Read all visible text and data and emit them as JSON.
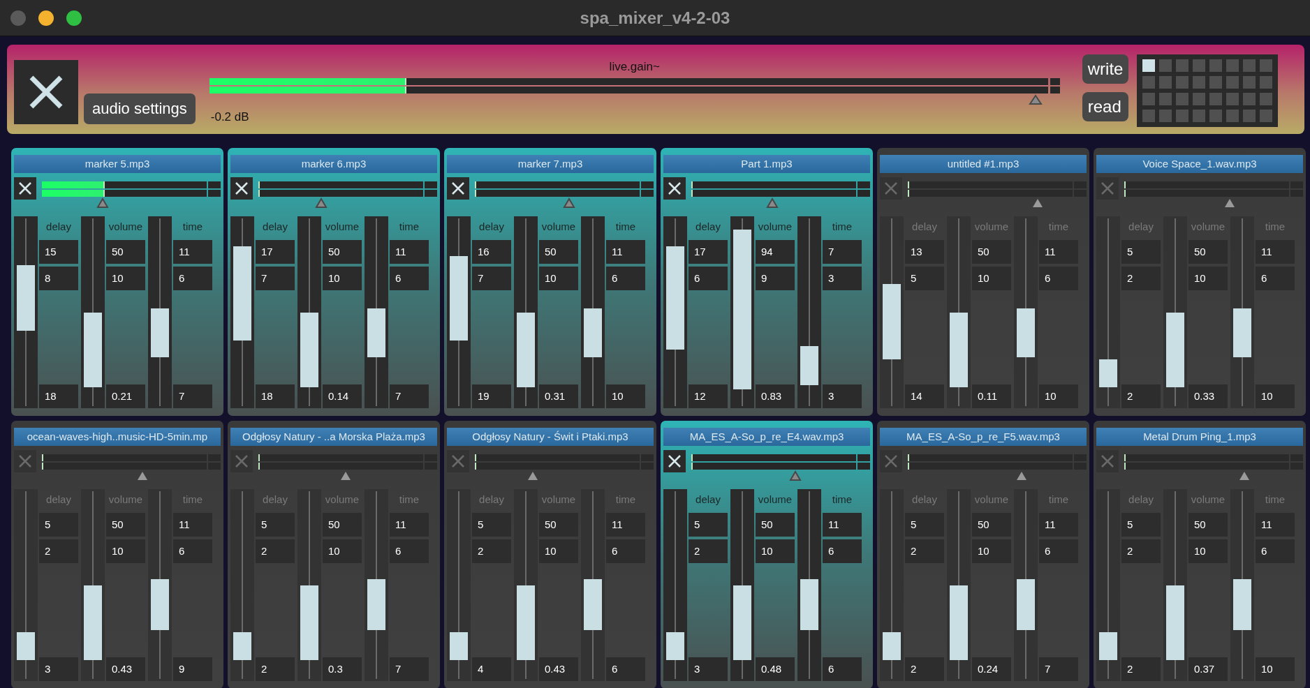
{
  "window": {
    "title": "spa_mixer_v4-2-03"
  },
  "header": {
    "settings_button": "audio settings",
    "gain_label": "live.gain~",
    "meter": {
      "level": 0.235
    },
    "gain_slider": {
      "level": 0.985
    },
    "gain_reading": "-0.2 dB",
    "write_button": "write",
    "read_button": "read",
    "presets": [
      {
        "selected": true
      },
      {
        "selected": false
      },
      {
        "selected": false
      },
      {
        "selected": false
      },
      {
        "selected": false
      },
      {
        "selected": false
      },
      {
        "selected": false
      },
      {
        "selected": false
      },
      {
        "selected": false
      },
      {
        "selected": false
      },
      {
        "selected": false
      },
      {
        "selected": false
      },
      {
        "selected": false
      },
      {
        "selected": false
      },
      {
        "selected": false
      },
      {
        "selected": false
      },
      {
        "selected": false
      },
      {
        "selected": false
      },
      {
        "selected": false
      },
      {
        "selected": false
      },
      {
        "selected": false
      },
      {
        "selected": false
      },
      {
        "selected": false
      },
      {
        "selected": false
      },
      {
        "selected": false
      },
      {
        "selected": false
      },
      {
        "selected": false
      },
      {
        "selected": false
      },
      {
        "selected": false
      },
      {
        "selected": false
      },
      {
        "selected": false
      },
      {
        "selected": false
      }
    ]
  },
  "channels": [
    {
      "name": "marker 5.mp3",
      "on": true,
      "meter": {
        "level": 0.38
      },
      "gain": {
        "level": 0.37
      },
      "params": [
        {
          "label": "delay",
          "value_1": "15",
          "value_2": "8",
          "value_3": "18",
          "low": {
            "level": 0.4
          },
          "high": {
            "level": 0.75
          }
        },
        {
          "label": "volume",
          "value_1": "50",
          "value_2": "10",
          "value_3": "0.21",
          "low": {
            "level": 0.1
          },
          "high": {
            "level": 0.5
          }
        },
        {
          "label": "time",
          "value_1": "11",
          "value_2": "6",
          "value_3": "7",
          "low": {
            "level": 0.26
          },
          "high": {
            "level": 0.52
          }
        }
      ]
    },
    {
      "name": "marker 6.mp3",
      "on": true,
      "meter": {
        "level": 0
      },
      "gain": {
        "level": 0.38
      },
      "params": [
        {
          "label": "delay",
          "value_1": "17",
          "value_2": "7",
          "value_3": "18",
          "low": {
            "level": 0.35
          },
          "high": {
            "level": 0.85
          }
        },
        {
          "label": "volume",
          "value_1": "50",
          "value_2": "10",
          "value_3": "0.14",
          "low": {
            "level": 0.1
          },
          "high": {
            "level": 0.5
          }
        },
        {
          "label": "time",
          "value_1": "11",
          "value_2": "6",
          "value_3": "7",
          "low": {
            "level": 0.26
          },
          "high": {
            "level": 0.52
          }
        }
      ]
    },
    {
      "name": "marker 7.mp3",
      "on": true,
      "meter": {
        "level": 0
      },
      "gain": {
        "level": 0.57
      },
      "params": [
        {
          "label": "delay",
          "value_1": "16",
          "value_2": "7",
          "value_3": "19",
          "low": {
            "level": 0.35
          },
          "high": {
            "level": 0.8
          }
        },
        {
          "label": "volume",
          "value_1": "50",
          "value_2": "10",
          "value_3": "0.31",
          "low": {
            "level": 0.1
          },
          "high": {
            "level": 0.5
          }
        },
        {
          "label": "time",
          "value_1": "11",
          "value_2": "6",
          "value_3": "10",
          "low": {
            "level": 0.26
          },
          "high": {
            "level": 0.52
          }
        }
      ]
    },
    {
      "name": "Part 1.mp3",
      "on": true,
      "meter": {
        "level": 0
      },
      "gain": {
        "level": 0.49
      },
      "params": [
        {
          "label": "delay",
          "value_1": "17",
          "value_2": "6",
          "value_3": "12",
          "low": {
            "level": 0.3
          },
          "high": {
            "level": 0.85
          }
        },
        {
          "label": "volume",
          "value_1": "94",
          "value_2": "9",
          "value_3": "0.83",
          "low": {
            "level": 0.09
          },
          "high": {
            "level": 0.94
          }
        },
        {
          "label": "time",
          "value_1": "7",
          "value_2": "3",
          "value_3": "3",
          "low": {
            "level": 0.11
          },
          "high": {
            "level": 0.32
          }
        }
      ]
    },
    {
      "name": "untitled #1.mp3",
      "on": false,
      "meter": {
        "level": 0
      },
      "gain": {
        "level": 0.79
      },
      "params": [
        {
          "label": "delay",
          "value_1": "13",
          "value_2": "5",
          "value_3": "14",
          "low": {
            "level": 0.25
          },
          "high": {
            "level": 0.65
          }
        },
        {
          "label": "volume",
          "value_1": "50",
          "value_2": "10",
          "value_3": "0.11",
          "low": {
            "level": 0.1
          },
          "high": {
            "level": 0.5
          }
        },
        {
          "label": "time",
          "value_1": "11",
          "value_2": "6",
          "value_3": "10",
          "low": {
            "level": 0.26
          },
          "high": {
            "level": 0.52
          }
        }
      ]
    },
    {
      "name": "Voice Space_1.wav.mp3",
      "on": false,
      "meter": {
        "level": 0
      },
      "gain": {
        "level": 0.64
      },
      "params": [
        {
          "label": "delay",
          "value_1": "5",
          "value_2": "2",
          "value_3": "2",
          "low": {
            "level": 0.1
          },
          "high": {
            "level": 0.25
          }
        },
        {
          "label": "volume",
          "value_1": "50",
          "value_2": "10",
          "value_3": "0.33",
          "low": {
            "level": 0.1
          },
          "high": {
            "level": 0.5
          }
        },
        {
          "label": "time",
          "value_1": "11",
          "value_2": "6",
          "value_3": "10",
          "low": {
            "level": 0.26
          },
          "high": {
            "level": 0.52
          }
        }
      ]
    },
    {
      "name": "ocean-waves-high..music-HD-5min.mp",
      "on": false,
      "meter": {
        "level": 0
      },
      "gain": {
        "level": 0.61
      },
      "params": [
        {
          "label": "delay",
          "value_1": "5",
          "value_2": "2",
          "value_3": "3",
          "low": {
            "level": 0.1
          },
          "high": {
            "level": 0.25
          }
        },
        {
          "label": "volume",
          "value_1": "50",
          "value_2": "10",
          "value_3": "0.43",
          "low": {
            "level": 0.1
          },
          "high": {
            "level": 0.5
          }
        },
        {
          "label": "time",
          "value_1": "11",
          "value_2": "6",
          "value_3": "9",
          "low": {
            "level": 0.26
          },
          "high": {
            "level": 0.53
          }
        }
      ]
    },
    {
      "name": "Odgłosy Natury - ..a Morska Plaża.mp3",
      "on": false,
      "meter": {
        "level": 0
      },
      "gain": {
        "level": 0.53
      },
      "params": [
        {
          "label": "delay",
          "value_1": "5",
          "value_2": "2",
          "value_3": "2",
          "low": {
            "level": 0.1
          },
          "high": {
            "level": 0.25
          }
        },
        {
          "label": "volume",
          "value_1": "50",
          "value_2": "10",
          "value_3": "0.3",
          "low": {
            "level": 0.1
          },
          "high": {
            "level": 0.5
          }
        },
        {
          "label": "time",
          "value_1": "11",
          "value_2": "6",
          "value_3": "7",
          "low": {
            "level": 0.26
          },
          "high": {
            "level": 0.53
          }
        }
      ]
    },
    {
      "name": "Odgłosy Natury - Świt i Ptaki.mp3",
      "on": false,
      "meter": {
        "level": 0
      },
      "gain": {
        "level": 0.35
      },
      "params": [
        {
          "label": "delay",
          "value_1": "5",
          "value_2": "2",
          "value_3": "4",
          "low": {
            "level": 0.1
          },
          "high": {
            "level": 0.25
          }
        },
        {
          "label": "volume",
          "value_1": "50",
          "value_2": "10",
          "value_3": "0.43",
          "low": {
            "level": 0.1
          },
          "high": {
            "level": 0.5
          }
        },
        {
          "label": "time",
          "value_1": "11",
          "value_2": "6",
          "value_3": "6",
          "low": {
            "level": 0.26
          },
          "high": {
            "level": 0.53
          }
        }
      ]
    },
    {
      "name": "MA_ES_A-So_p_re_E4.wav.mp3",
      "on": true,
      "meter": {
        "level": 0
      },
      "gain": {
        "level": 0.63
      },
      "params": [
        {
          "label": "delay",
          "value_1": "5",
          "value_2": "2",
          "value_3": "3",
          "low": {
            "level": 0.1
          },
          "high": {
            "level": 0.25
          }
        },
        {
          "label": "volume",
          "value_1": "50",
          "value_2": "10",
          "value_3": "0.48",
          "low": {
            "level": 0.1
          },
          "high": {
            "level": 0.5
          }
        },
        {
          "label": "time",
          "value_1": "11",
          "value_2": "6",
          "value_3": "6",
          "low": {
            "level": 0.26
          },
          "high": {
            "level": 0.53
          }
        }
      ]
    },
    {
      "name": "MA_ES_A-So_p_re_F5.wav.mp3",
      "on": false,
      "meter": {
        "level": 0
      },
      "gain": {
        "level": 0.69
      },
      "params": [
        {
          "label": "delay",
          "value_1": "5",
          "value_2": "2",
          "value_3": "2",
          "low": {
            "level": 0.1
          },
          "high": {
            "level": 0.25
          }
        },
        {
          "label": "volume",
          "value_1": "50",
          "value_2": "10",
          "value_3": "0.24",
          "low": {
            "level": 0.1
          },
          "high": {
            "level": 0.5
          }
        },
        {
          "label": "time",
          "value_1": "11",
          "value_2": "6",
          "value_3": "7",
          "low": {
            "level": 0.26
          },
          "high": {
            "level": 0.53
          }
        }
      ]
    },
    {
      "name": "Metal Drum Ping_1.mp3",
      "on": false,
      "meter": {
        "level": 0
      },
      "gain": {
        "level": 0.73
      },
      "params": [
        {
          "label": "delay",
          "value_1": "5",
          "value_2": "2",
          "value_3": "2",
          "low": {
            "level": 0.1
          },
          "high": {
            "level": 0.25
          }
        },
        {
          "label": "volume",
          "value_1": "50",
          "value_2": "10",
          "value_3": "0.37",
          "low": {
            "level": 0.1
          },
          "high": {
            "level": 0.5
          }
        },
        {
          "label": "time",
          "value_1": "11",
          "value_2": "6",
          "value_3": "10",
          "low": {
            "level": 0.26
          },
          "high": {
            "level": 0.53
          }
        }
      ]
    }
  ]
}
